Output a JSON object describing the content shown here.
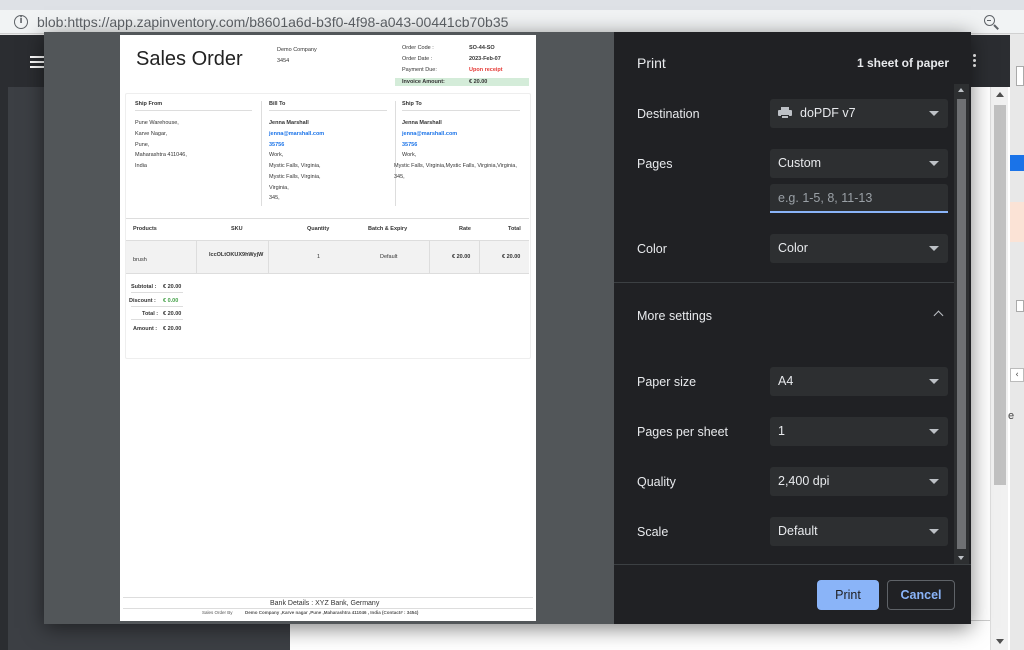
{
  "browser": {
    "url": "blob:https://app.zapinventory.com/b8601a6d-b3f0-4f98-a043-00441cb70b35",
    "info_icon": "i"
  },
  "document": {
    "title": "Sales Order",
    "company_name": "Demo Company",
    "company_code": "3454",
    "meta": {
      "order_code_label": "Order Code :",
      "order_code": "SO-44-SO",
      "order_date_label": "Order Date :",
      "order_date": "2023-Feb-07",
      "payment_due_label": "Payment Due:",
      "payment_due": "Upon receipt",
      "invoice_amount_label": "Invoice Amount:",
      "invoice_amount": "€ 20.00"
    },
    "ship_from": {
      "heading": "Ship From",
      "lines": [
        "Pune Warehouse,",
        "Karve Nagar,",
        "Pune,",
        "Maharashtra 411046,",
        "India"
      ]
    },
    "bill_to": {
      "heading": "Bill To",
      "name": "Jenna Marshall",
      "email": "jenna@marshall.com",
      "phone": "35756",
      "lines": [
        "Work,",
        "Mystic Falls, Virginia,",
        "Mystic Falls, Virginia,",
        "Virginia,",
        "345,"
      ]
    },
    "ship_to": {
      "heading": "Ship To",
      "name": "Jenna Marshall",
      "email": "jenna@marshall.com",
      "phone": "35756",
      "lines": [
        "Work,",
        "Mystic Falls, Virginia,Mystic Falls, Virginia,Virginia,",
        "345,"
      ]
    },
    "table": {
      "headers": [
        "Products",
        "SKU",
        "Quantity",
        "Batch & Expiry",
        "Rate",
        "Total"
      ],
      "rows": [
        {
          "product": "brush",
          "sku": "lccOLtOKUX9hWyjW",
          "quantity": "1",
          "batch": "Default",
          "rate": "€ 20.00",
          "total": "€ 20.00"
        }
      ]
    },
    "totals": {
      "subtotal_label": "Subtotal :",
      "subtotal": "€ 20.00",
      "discount_label": "Discount :",
      "discount": "€ 0.00",
      "total_label": "Total :",
      "total": "€ 20.00",
      "amount_label": "Amount :",
      "amount": "€ 20.00"
    },
    "footer": {
      "bank_details": "Bank Details : XYZ Bank, Germany",
      "sales_order_by": "Sales Order By",
      "address_line": "Demo Company ,Karve nagar ,Pune ,Maharashtra 411046 , India (Contact# : 3454)"
    }
  },
  "print": {
    "title": "Print",
    "sheets": "1 sheet of paper",
    "destination_label": "Destination",
    "destination_value": "doPDF v7",
    "pages_label": "Pages",
    "pages_value": "Custom",
    "pages_placeholder": "e.g. 1-5, 8, 11-13",
    "color_label": "Color",
    "color_value": "Color",
    "more_settings_label": "More settings",
    "paper_size_label": "Paper size",
    "paper_size_value": "A4",
    "pages_per_sheet_label": "Pages per sheet",
    "pages_per_sheet_value": "1",
    "quality_label": "Quality",
    "quality_value": "2,400 dpi",
    "scale_label": "Scale",
    "scale_value": "Default",
    "print_button": "Print",
    "cancel_button": "Cancel",
    "accent_color": "#8ab4f8"
  }
}
